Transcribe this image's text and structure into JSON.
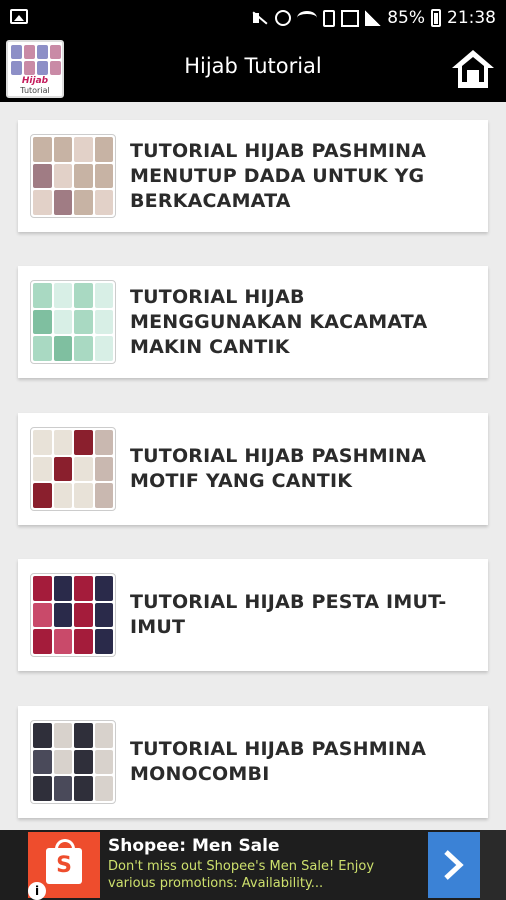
{
  "status_bar": {
    "battery": "85%",
    "time": "21:38",
    "icons": [
      "image-icon",
      "mute-icon",
      "alarm-icon",
      "wifi-icon",
      "sim-icon",
      "signal-box-icon",
      "signal-bars-icon",
      "battery-icon"
    ]
  },
  "app_bar": {
    "title": "Hijab Tutorial",
    "logo_text_top": "Hijab",
    "logo_text_bottom": "Tutorial",
    "home_icon": "home-icon"
  },
  "items": [
    {
      "label": "TUTORIAL HIJAB PASHMINA MENUTUP DADA UNTUK YG BERKACAMATA"
    },
    {
      "label": "TUTORIAL HIJAB MENGGUNAKAN KACAMATA MAKIN CANTIK"
    },
    {
      "label": "TUTORIAL HIJAB PASHMINA MOTIF YANG CANTIK"
    },
    {
      "label": "TUTORIAL HIJAB PESTA IMUT-IMUT"
    },
    {
      "label": "TUTORIAL HIJAB PASHMINA MONOCOMBI"
    }
  ],
  "ad": {
    "headline": "Shopee: Men Sale",
    "body": "Don't miss out Shopee's Men Sale! Enjoy various promotions: Availability...",
    "info": "i",
    "colors": {
      "brand": "#ee4d2d",
      "cta": "#3b82d6",
      "body_text": "#cde06d"
    }
  }
}
